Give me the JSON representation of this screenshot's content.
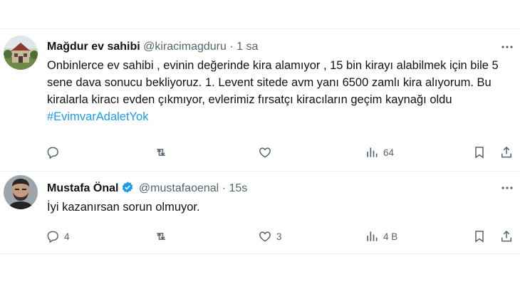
{
  "tweets": [
    {
      "name": "Mağdur ev sahibi",
      "handle": "@kiracimagduru",
      "dot": "·",
      "time": "1 sa",
      "text": "Onbinlerce ev sahibi , evinin değerinde kira alamıyor , 15 bin kirayı alabilmek için bile 5 sene dava sonucu bekliyoruz. 1. Levent sitede avm yanı 6500 zamlı kira alıyorum. Bu kiralarla kiracı evden çıkmıyor, evlerimiz fırsatçı kiracıların geçim kaynağı oldu ",
      "hashtag": "#EvimvarAdaletYok",
      "verified": false,
      "replies": "",
      "retweets": "",
      "likes": "",
      "views": "64"
    },
    {
      "name": "Mustafa Önal",
      "handle": "@mustafaoenal",
      "dot": "·",
      "time": "15s",
      "text": "İyi kazanırsan sorun olmuyor.",
      "hashtag": "",
      "verified": true,
      "replies": "4",
      "retweets": "",
      "likes": "3",
      "views": "4 B"
    }
  ],
  "colors": {
    "text": "#0f1419",
    "muted": "#536471",
    "link": "#1d9bf0",
    "verified": "#1d9bf0",
    "separator": "#eff3f4"
  },
  "icons": [
    "reply-icon",
    "retweet-icon",
    "like-icon",
    "views-icon",
    "bookmark-icon",
    "share-icon",
    "more-icon",
    "verified-badge-icon"
  ]
}
